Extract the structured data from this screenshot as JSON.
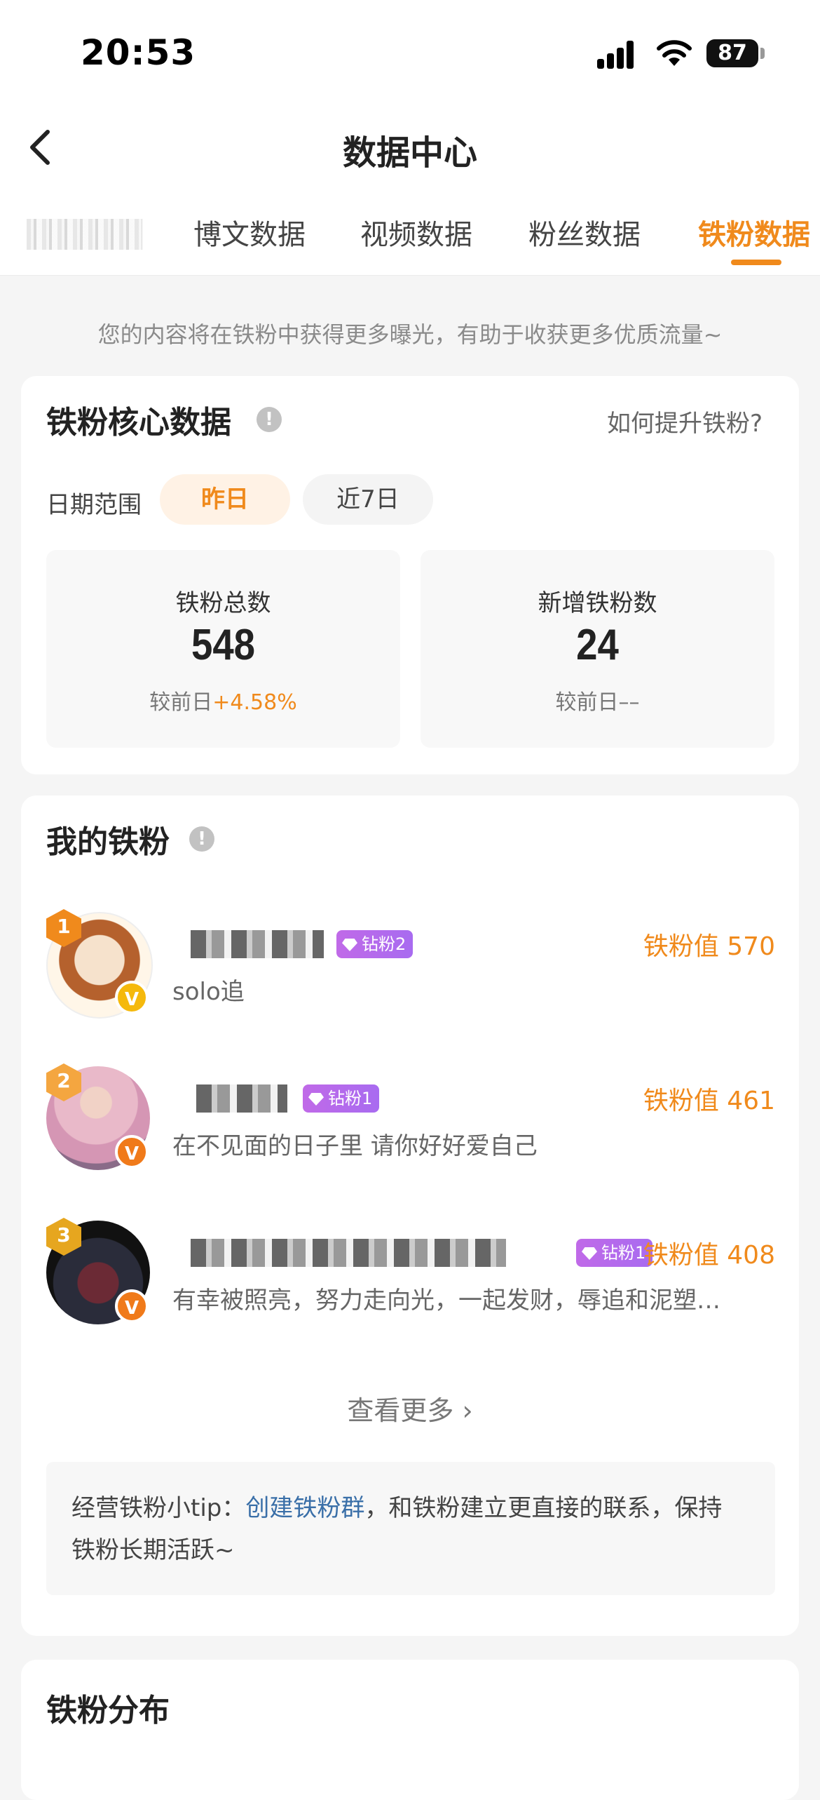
{
  "status_bar": {
    "time": "20:53",
    "battery": "87"
  },
  "nav": {
    "title": "数据中心"
  },
  "tabs": [
    {
      "label": "博文数据"
    },
    {
      "label": "视频数据"
    },
    {
      "label": "粉丝数据"
    },
    {
      "label": "铁粉数据",
      "active": true
    }
  ],
  "intro": "您的内容将在铁粉中获得更多曝光，有助于收获更多优质流量~",
  "core": {
    "title": "铁粉核心数据",
    "info_mark": "!",
    "help_link": "如何提升铁粉?",
    "date_range_label": "日期范围",
    "chips": [
      {
        "label": "昨日",
        "selected": true
      },
      {
        "label": "近7日",
        "selected": false
      }
    ],
    "stats": [
      {
        "label": "铁粉总数",
        "value": "548",
        "compare_prefix": "较前日",
        "compare_value": "+4.58%"
      },
      {
        "label": "新增铁粉数",
        "value": "24",
        "compare_prefix": "较前日",
        "compare_value": "––"
      }
    ]
  },
  "my_fans": {
    "title": "我的铁粉",
    "info_mark": "!",
    "items": [
      {
        "rank": "1",
        "badge": "钻粉2",
        "value": "铁粉值 570",
        "signature": "solo追",
        "verified_mark": "V"
      },
      {
        "rank": "2",
        "badge": "钻粉1",
        "value": "铁粉值 461",
        "signature": "在不见面的日子里 请你好好爱自己",
        "verified_mark": "V"
      },
      {
        "rank": "3",
        "badge": "钻粉1",
        "value": "铁粉值 408",
        "signature": "有幸被照亮，努力走向光，一起发财，辱追和泥塑…",
        "verified_mark": "V"
      }
    ],
    "view_more": "查看更多 ›",
    "tip_prefix": "经营铁粉小tip：",
    "tip_link": "创建铁粉群",
    "tip_suffix": "，和铁粉建立更直接的联系，保持铁粉长期活跃~"
  },
  "distribution": {
    "title": "铁粉分布"
  },
  "colors": {
    "accent": "#f08a1c",
    "link": "#3a6fa8",
    "badge": "#b46bec"
  }
}
